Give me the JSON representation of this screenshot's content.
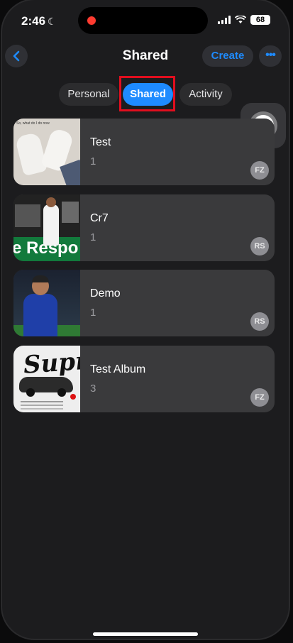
{
  "status_bar": {
    "time": "2:46",
    "battery": "68",
    "moon_icon": "moon-icon",
    "recording_color": "#ff3b30"
  },
  "header": {
    "title": "Shared",
    "create_label": "Create",
    "more_label": "•••",
    "back_icon": "chevron-left-icon",
    "accent_color": "#1e8bff"
  },
  "tabs": [
    {
      "label": "Personal",
      "selected": false
    },
    {
      "label": "Shared",
      "selected": true
    },
    {
      "label": "Activity",
      "selected": false
    }
  ],
  "albums": [
    {
      "name": "Test",
      "count": "1",
      "owner_initials": "FZ",
      "thumb_caption": "So, what do I do now"
    },
    {
      "name": "Cr7",
      "count": "1",
      "owner_initials": "RS",
      "thumb_text": "e Respo"
    },
    {
      "name": "Demo",
      "count": "1",
      "owner_initials": "RS"
    },
    {
      "name": "Test Album",
      "count": "3",
      "owner_initials": "FZ",
      "thumb_text": "Supra"
    }
  ]
}
